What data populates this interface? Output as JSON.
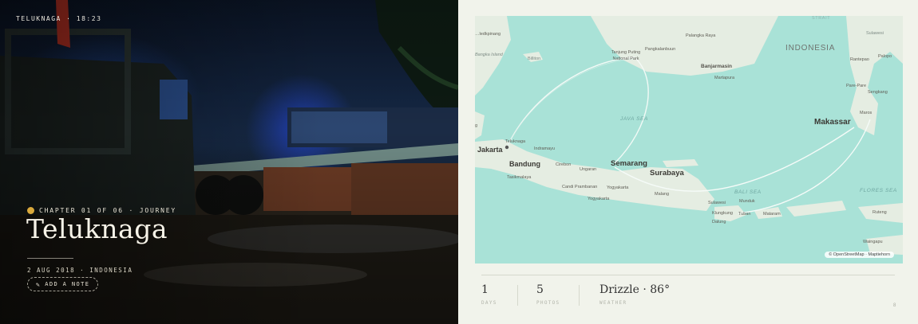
{
  "photo": {
    "location_time": "TELUKNAGA · 18:23",
    "chapter": "CHAPTER 01 OF 06 · JOURNEY",
    "title": "Teluknaga",
    "meta": "2 AUG 2018 · INDONESIA",
    "add_note_label": "ADD A NOTE",
    "chapter_dot_color": "#d9a93c"
  },
  "map": {
    "labels": {
      "strait": "STRAIT",
      "kelapa": "…ledkpinang",
      "bangka": "Bangka Island",
      "billiton": "Billiton",
      "palangka": "Palangka Raya",
      "tanjung": "Tanjung Puting National Park",
      "pangkalan": "Pangkalanbuun",
      "banjarmasin": "Banjarmasin",
      "martapura": "Martapura",
      "indonesia": "INDONESIA",
      "sulawesi": "Sulawesi",
      "rantepao": "Rantepao",
      "palopo": "Palopo",
      "parepare": "Pare-Pare",
      "sengkang": "Sengkang",
      "makassar": "Makassar",
      "maros": "Maros",
      "java_sea": "JAVA SEA",
      "teluknaga": "Teluknaga",
      "jakarta": "Jakarta",
      "indramayu": "Indramayu",
      "cirebon": "Cirebon",
      "bandung": "Bandung",
      "tasikmalaya": "Tasikmalaya",
      "semarang": "Semarang",
      "surabaya": "Surabaya",
      "ungaran": "Ungaran",
      "candi": "Candi Prambanan",
      "yogyakarta1": "Yogyakarta",
      "yogyakarta2": "Yogyakarta",
      "malang": "Malang",
      "bali_sea": "BALI SEA",
      "flores_sea": "FLORES SEA",
      "sulawesi2": "Sulawesi",
      "munduk": "Munduk",
      "klungkung": "Klungkung",
      "tuban": "Tuban",
      "mataram": "Mataram",
      "dalung": "Dalung",
      "ruteng": "Ruteng",
      "waingapu": "Waingapu",
      "g": "g"
    },
    "attribution": "© OpenStreetMap · Maptiehorn"
  },
  "stats": [
    {
      "value": "1",
      "key": "DAYS"
    },
    {
      "value": "5",
      "key": "PHOTOS"
    },
    {
      "value": "Drizzle · 86°",
      "key": "WEATHER"
    }
  ],
  "page_number": "8"
}
